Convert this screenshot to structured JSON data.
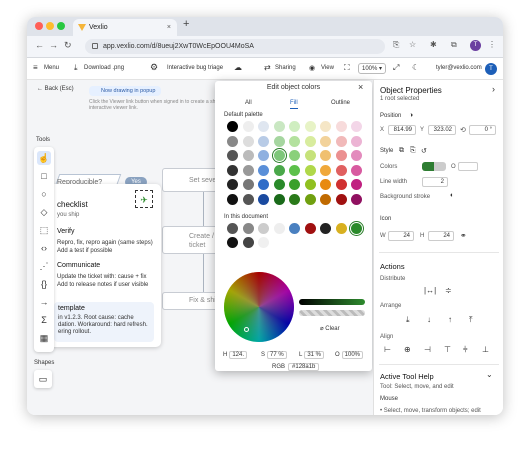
{
  "browser": {
    "tab_title": "Vexlio",
    "tab_close": "×",
    "new_tab": "+",
    "url": "app.vexlio.com/d/8ueuj2XwT0WcEpOOU4MoSA",
    "profile_initial": "T"
  },
  "toolbar": {
    "menu": "Menu",
    "download": "Download .png",
    "bug_triage": "Interactive bug triage",
    "sharing": "Sharing",
    "view": "View",
    "zoom": "100%",
    "email": "tyler@vexlio.com",
    "avatar_initial": "T"
  },
  "canvas": {
    "back": "Back (Esc)",
    "notice_pill": "Now drawing in popup",
    "notice_text": "Click the Viewer link button when signed in to create a shareable, interactive viewer link.",
    "tools_label": "Tools",
    "shapes_label": "Shapes",
    "reproducible": "Reproducible?",
    "yes": "Yes",
    "set_severity": "Set seve",
    "create_ticket_1": "Create /",
    "create_ticket_2": "ticket",
    "fix_ship": "Fix & shi"
  },
  "checklist": {
    "title": "checklist",
    "subtitle": "you ship",
    "verify": "Verify",
    "verify_1": "Repro, fix, repro again (same steps)",
    "verify_2": "Add a test if possible",
    "communicate": "Communicate",
    "comm_1": "Update the ticket with: cause + fix",
    "comm_2": "Add to release notes if user visible",
    "template": "template",
    "template_1": "in v1.2.3. Root cause: cache",
    "template_2": "dation. Workaround: hard refresh.",
    "template_3": "ering rollout."
  },
  "color_popup": {
    "title": "Edit object colors",
    "tabs": [
      "All",
      "Fill",
      "Outline"
    ],
    "active_tab": "Fill",
    "default_palette": "Default palette",
    "in_document": "In this document",
    "clear": "Clear",
    "h_label": "H",
    "h_value": "124.",
    "s_label": "S",
    "s_value": "77 %",
    "l_label": "L",
    "l_value": "31 %",
    "o_label": "O",
    "o_value": "100%",
    "rgb_label": "RGB",
    "rgb_value": "#128a1b",
    "palette_colors": [
      "#000000",
      "#eeeeee",
      "#dfe6f0",
      "#c9e7c2",
      "#cfeec0",
      "#e7f3c6",
      "#f5e6c6",
      "#f7dbdb",
      "#f3d6e8",
      "#888888",
      "#dddddd",
      "#b8cbe6",
      "#a6d6a0",
      "#b3e19e",
      "#d8ec9e",
      "#f2d29a",
      "#f1b9b9",
      "#ecb4d4",
      "#555555",
      "#bbbbbb",
      "#8fb0e0",
      "#7ec77a",
      "#8ad07a",
      "#c6e27a",
      "#f0c070",
      "#eb9090",
      "#e38bbd",
      "#333333",
      "#999999",
      "#5a8fd8",
      "#4aa84a",
      "#5cc04a",
      "#b0d84a",
      "#f0a83a",
      "#e06060",
      "#d85aa0",
      "#222222",
      "#777777",
      "#2f6cc8",
      "#2a8a2a",
      "#3aa02a",
      "#90c020",
      "#e88a10",
      "#d03030",
      "#c02080",
      "#111111",
      "#555555",
      "#1a4aa0",
      "#1a6a1a",
      "#2a7a1a",
      "#70a010",
      "#c06a00",
      "#a01010",
      "#901060"
    ],
    "doc_colors": [
      "#555555",
      "#888888",
      "#cccccc",
      "#eeeeee",
      "#4a80c0",
      "#a01010",
      "#222222",
      "#d8b020",
      "#2a8a2a",
      "#111111",
      "#444444",
      "#f0f0f0"
    ]
  },
  "object_panel": {
    "title": "Object Properties",
    "subtitle": "1 root selected",
    "position": "Position",
    "x_label": "X",
    "x_value": "814.99",
    "y_label": "Y",
    "y_value": "323.02",
    "rot_value": "0 °",
    "style": "Style",
    "colors": "Colors",
    "line_width": "Line width",
    "line_width_value": "2",
    "background_stroke": "Background stroke",
    "icon": "Icon",
    "w_label": "W",
    "w_value": "24",
    "h_label": "H",
    "h_value": "24",
    "actions": "Actions",
    "distribute": "Distribute",
    "arrange": "Arrange",
    "align": "Align",
    "active_tool_help": "Active Tool Help",
    "tool_desc": "Tool: Select, move, and edit",
    "mouse": "Mouse",
    "mouse_desc": "• Select, move, transform objects; edit"
  },
  "colors": {
    "brand": "#1d5fb8",
    "active_fill": "#128a1b"
  }
}
